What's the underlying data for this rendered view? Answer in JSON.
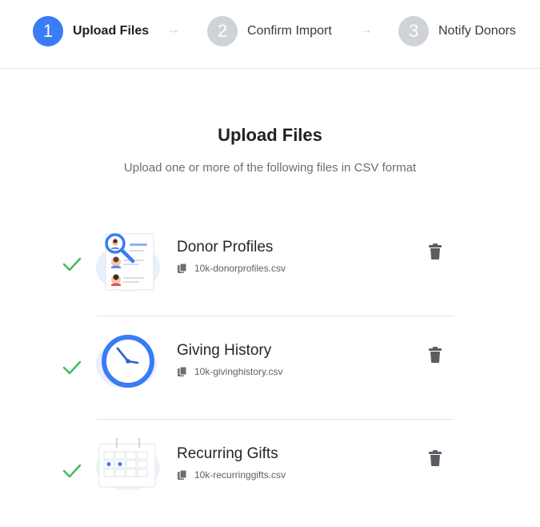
{
  "stepper": {
    "steps": [
      {
        "number": "1",
        "label": "Upload Files",
        "active": true
      },
      {
        "number": "2",
        "label": "Confirm Import",
        "active": false
      },
      {
        "number": "3",
        "label": "Notify Donors",
        "active": false
      }
    ],
    "arrow": "→"
  },
  "main": {
    "title": "Upload Files",
    "subtitle": "Upload one or more of the following files in CSV format"
  },
  "files": [
    {
      "name": "Donor Profiles",
      "filename": "10k-donorprofiles.csv",
      "status": "uploaded",
      "icon": "donor-profiles-icon"
    },
    {
      "name": "Giving History",
      "filename": "10k-givinghistory.csv",
      "status": "uploaded",
      "icon": "clock-icon"
    },
    {
      "name": "Recurring Gifts",
      "filename": "10k-recurringgifts.csv",
      "status": "uploaded",
      "icon": "calendar-icon"
    }
  ],
  "colors": {
    "accent": "#3a7bf6",
    "inactive_step": "#cfd2d6",
    "success": "#3dbb61",
    "delete_icon": "#5a5e63"
  }
}
